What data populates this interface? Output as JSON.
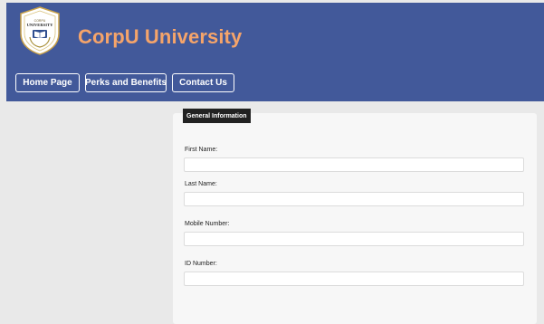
{
  "brand": {
    "name": "CorpU University",
    "logo_text_top": "CORPU",
    "logo_text_main": "UNIVERSITY",
    "colors": {
      "header_bg": "#42599a",
      "brand_text": "#f5a46a"
    }
  },
  "nav": {
    "items": [
      {
        "label": "Home Page"
      },
      {
        "label": "Perks and Benefits"
      },
      {
        "label": "Contact Us"
      }
    ]
  },
  "form": {
    "legend": "General Information",
    "fields": [
      {
        "label": "First Name:",
        "value": "",
        "placeholder": ""
      },
      {
        "label": "Last Name:",
        "value": "",
        "placeholder": ""
      },
      {
        "label": "Mobile Number:",
        "value": "",
        "placeholder": ""
      },
      {
        "label": "ID Number:",
        "value": "",
        "placeholder": ""
      }
    ]
  }
}
